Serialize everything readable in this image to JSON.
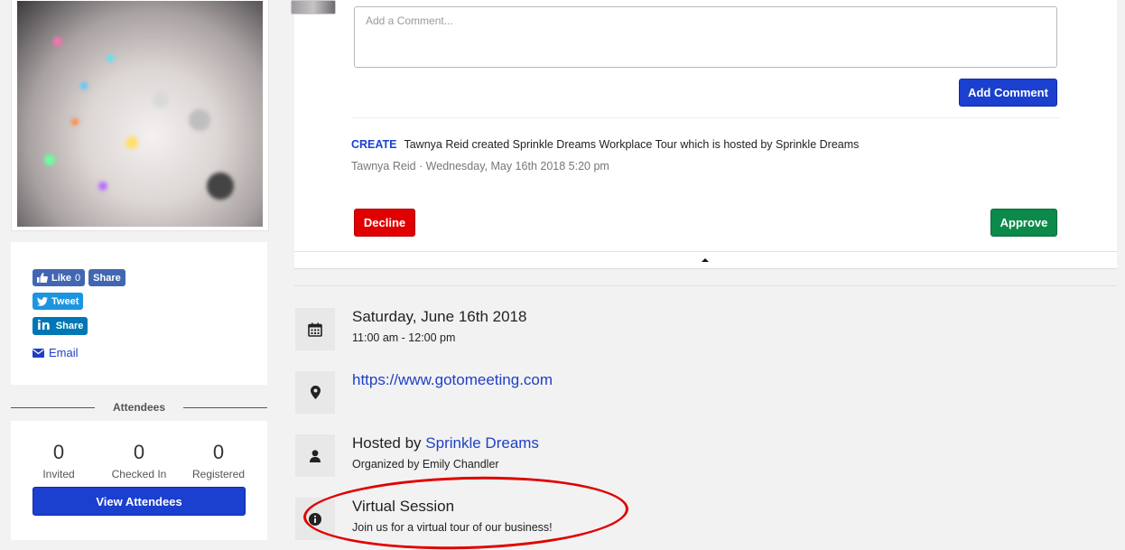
{
  "sidebar": {
    "share": {
      "like_label": "Like",
      "like_count": "0",
      "fb_share_label": "Share",
      "tweet_label": "Tweet",
      "linkedin_label": "Share",
      "email_label": "Email"
    },
    "attendees": {
      "heading": "Attendees",
      "stats": [
        {
          "value": "0",
          "label": "Invited"
        },
        {
          "value": "0",
          "label": "Checked In"
        },
        {
          "value": "0",
          "label": "Registered"
        }
      ],
      "view_button": "View Attendees"
    }
  },
  "activity": {
    "comment_placeholder": "Add a Comment...",
    "add_comment_label": "Add Comment",
    "log": {
      "type": "CREATE",
      "message": "Tawnya Reid created Sprinkle Dreams Workplace Tour which is hosted by Sprinkle Dreams",
      "meta": "Tawnya Reid · Wednesday, May 16th 2018 5:20 pm"
    },
    "decline_label": "Decline",
    "approve_label": "Approve"
  },
  "details": {
    "date": {
      "title": "Saturday, June 16th 2018",
      "sub": "11:00 am - 12:00 pm",
      "icon": "calendar-icon"
    },
    "location": {
      "link": "https://www.gotomeeting.com",
      "icon": "map-marker-icon"
    },
    "host": {
      "prefix": "Hosted by",
      "name": "Sprinkle Dreams",
      "sub": "Organized by Emily Chandler",
      "icon": "user-icon"
    },
    "info": {
      "title": "Virtual Session",
      "sub": "Join us for a virtual tour of our business!",
      "icon": "info-circle-icon"
    }
  },
  "colors": {
    "primary": "#1b3fcf",
    "decline": "#e00000",
    "approve": "#0b8a4a",
    "annotation": "#e00000"
  }
}
